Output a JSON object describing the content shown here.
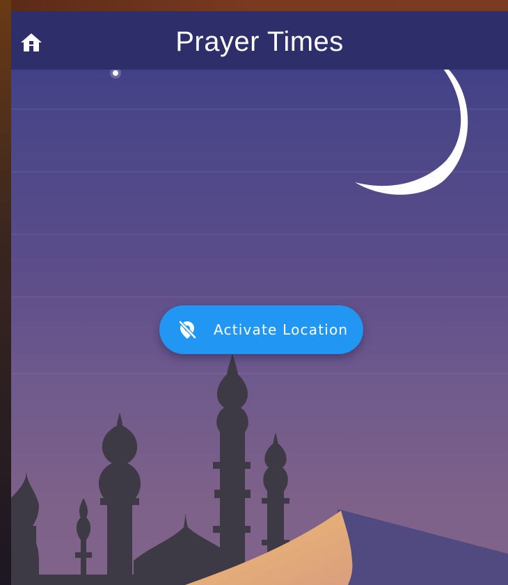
{
  "app": {
    "title": "Prayer Times"
  },
  "header": {
    "home_icon": "home-icon"
  },
  "location_button": {
    "label": "Activate Location",
    "icon": "location-off-icon",
    "color": "#2196f3"
  },
  "colors": {
    "appbar": "#2e2e6a",
    "sky_top": "#3a3a86",
    "sky_bottom": "#82648a",
    "silhouette": "#3e3a45",
    "dune": "#e8b87a",
    "moon": "#ffffff"
  }
}
